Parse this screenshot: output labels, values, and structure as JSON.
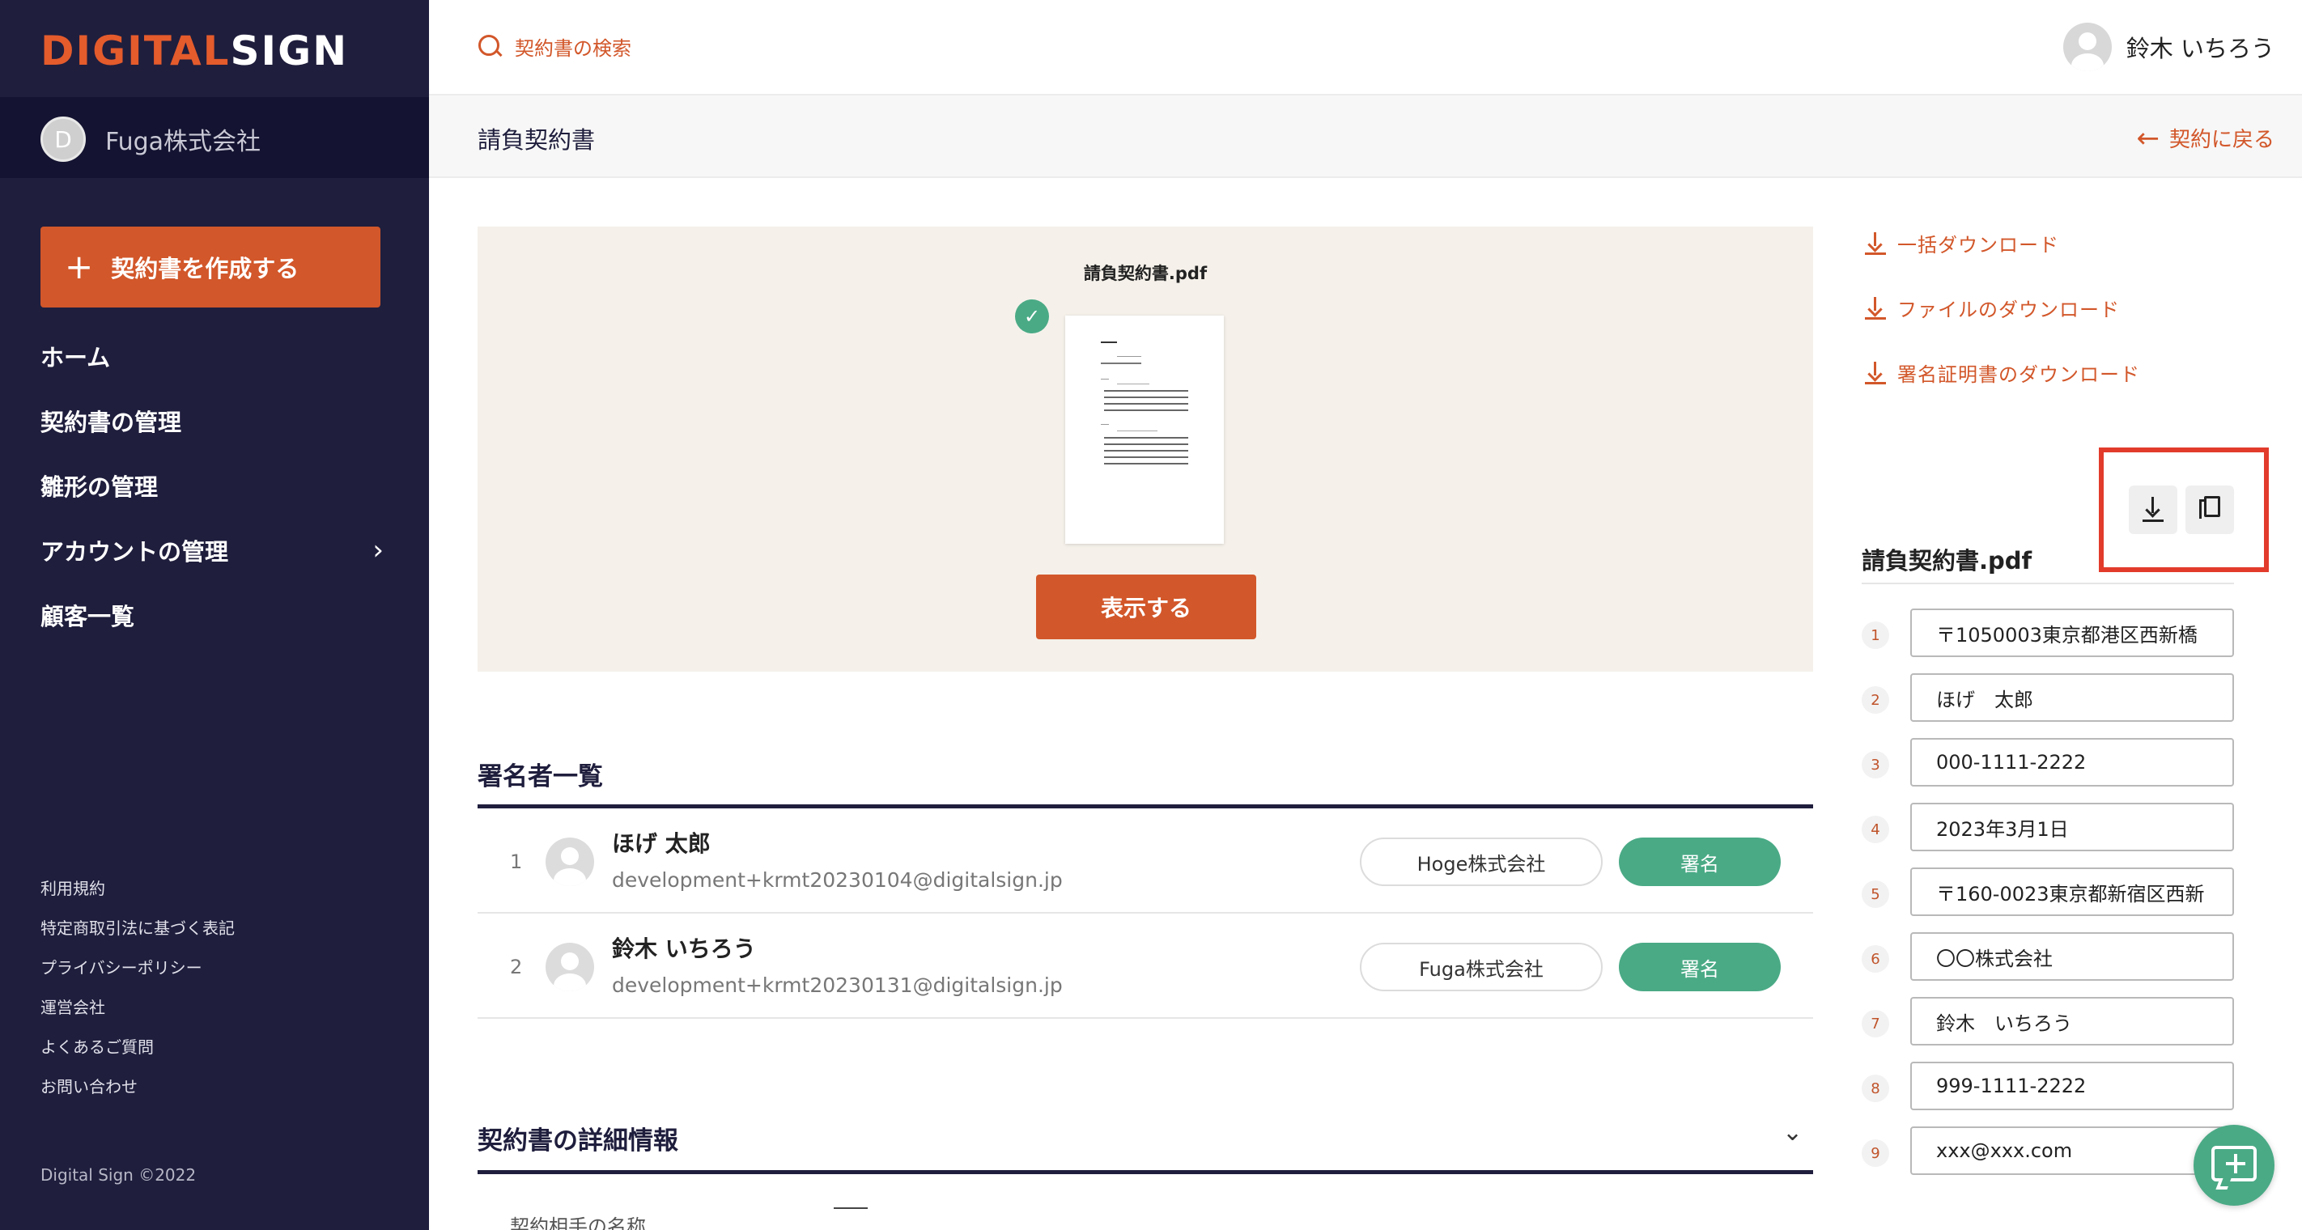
{
  "sidebar": {
    "logo_part1": "DIGITAL",
    "logo_part2": "SIGN",
    "company_initial": "D",
    "company_name": "Fuga株式会社",
    "create_button": "契約書を作成する",
    "nav": [
      {
        "label": "ホーム"
      },
      {
        "label": "契約書の管理"
      },
      {
        "label": "雛形の管理"
      },
      {
        "label": "アカウントの管理",
        "has_submenu": true
      },
      {
        "label": "顧客一覧"
      }
    ],
    "footer_links": [
      "利用規約",
      "特定商取引法に基づく表記",
      "プライバシーポリシー",
      "運営会社",
      "よくあるご質問",
      "お問い合わせ"
    ],
    "copyright": "Digital Sign ©2022"
  },
  "header": {
    "search_placeholder": "契約書の検索",
    "user_name": "鈴木 いちろう"
  },
  "subheader": {
    "title": "請負契約書",
    "back_label": "契約に戻る"
  },
  "preview": {
    "file_name": "請負契約書.pdf",
    "show_button": "表示する"
  },
  "signers": {
    "heading": "署名者一覧",
    "rows": [
      {
        "num": "1",
        "name": "ほげ 太郎",
        "email": "development+krmt20230104@digitalsign.jp",
        "company": "Hoge株式会社",
        "status": "署名"
      },
      {
        "num": "2",
        "name": "鈴木 いちろう",
        "email": "development+krmt20230131@digitalsign.jp",
        "company": "Fuga株式会社",
        "status": "署名"
      }
    ]
  },
  "details": {
    "heading": "契約書の詳細情報",
    "first_label": "契約相手の名称"
  },
  "right_panel": {
    "downloads": [
      "一括ダウンロード",
      "ファイルのダウンロード",
      "署名証明書のダウンロード"
    ],
    "file_title": "請負契約書.pdf",
    "fields": [
      {
        "num": "1",
        "value": "〒1050003東京都港区西新橋"
      },
      {
        "num": "2",
        "value": "ほげ　太郎"
      },
      {
        "num": "3",
        "value": "000-1111-2222"
      },
      {
        "num": "4",
        "value": "2023年3月1日"
      },
      {
        "num": "5",
        "value": "〒160-0023東京都新宿区西新"
      },
      {
        "num": "6",
        "value": "〇〇株式会社"
      },
      {
        "num": "7",
        "value": "鈴木　いちろう"
      },
      {
        "num": "8",
        "value": "999-1111-2222"
      },
      {
        "num": "9",
        "value": "xxx@xxx.com"
      }
    ]
  },
  "colors": {
    "sidebar_bg": "#1f1e3d",
    "accent": "#d2572a",
    "success": "#4aaa86",
    "highlight": "#e23b2c"
  }
}
